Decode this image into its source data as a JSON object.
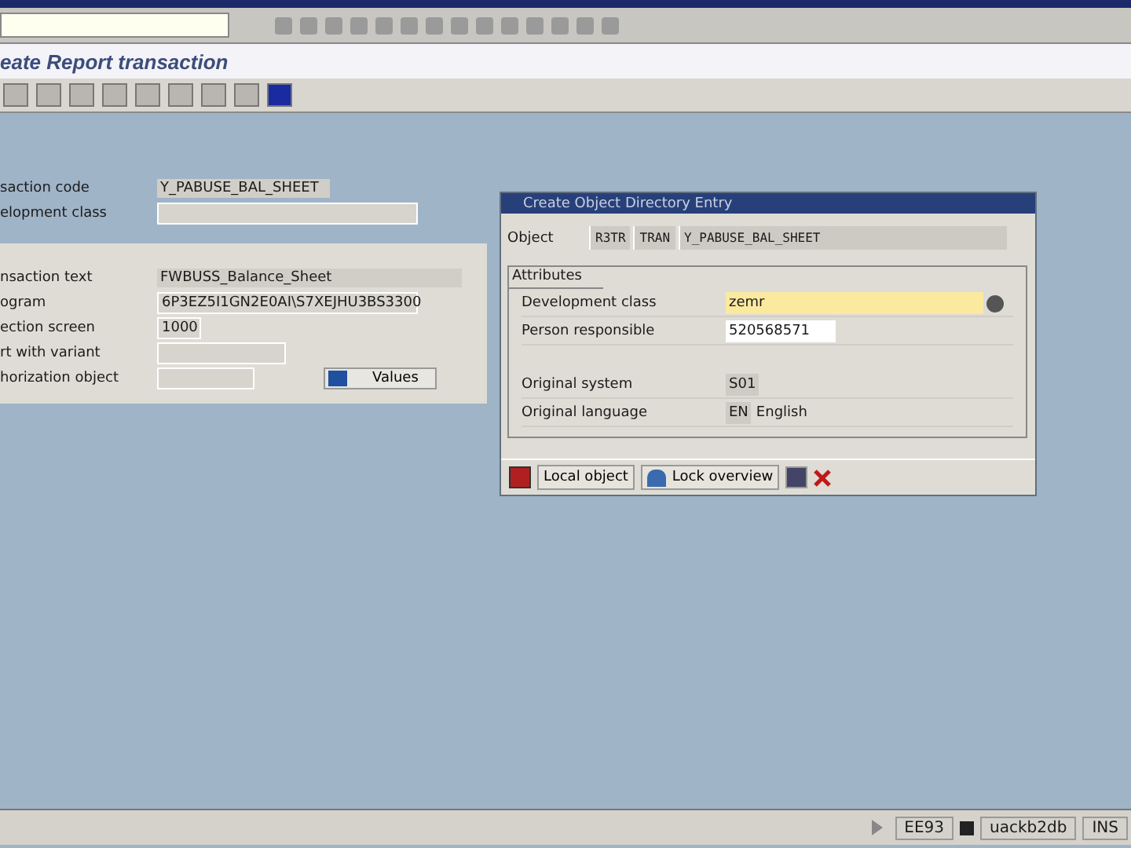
{
  "title": "eate Report transaction",
  "header_fields": [
    {
      "label": "saction code",
      "value": "Y_PABUSE_BAL_SHEET",
      "kind": "display"
    },
    {
      "label": "elopment class",
      "kind": "input"
    }
  ],
  "detail_fields": [
    {
      "label": "nsaction text",
      "value": "FWBUSS_Balance_Sheet",
      "kind": "display"
    },
    {
      "label": "ogram",
      "value": "6P3EZ5I1GN2E0AI\\S7XEJHU3BS3300",
      "kind": "input"
    },
    {
      "label": "ection screen",
      "value": "1000",
      "kind": "input"
    },
    {
      "label": "rt with variant",
      "kind": "input"
    },
    {
      "label": "horization object",
      "kind": "input"
    }
  ],
  "values_button": "Values",
  "dialog": {
    "title": "Create Object Directory Entry",
    "object_label": "Object",
    "object_parts": [
      "R3TR",
      "TRAN",
      "Y_PABUSE_BAL_SHEET"
    ],
    "attributes_tab": "Attributes",
    "fields": [
      {
        "label": "Development class",
        "value": "zemr",
        "kind": "input",
        "focused": true
      },
      {
        "label": "Person responsible",
        "value": "520568571",
        "kind": "input",
        "focused": false
      },
      {
        "label": "Original system",
        "value": "S01",
        "kind": "display"
      },
      {
        "label": "Original language",
        "value": "EN",
        "note": "English",
        "kind": "display"
      }
    ],
    "buttons": [
      "Local object",
      "Lock overview"
    ]
  },
  "status_bar": [
    "EE93",
    "uackb2db",
    "INS"
  ]
}
